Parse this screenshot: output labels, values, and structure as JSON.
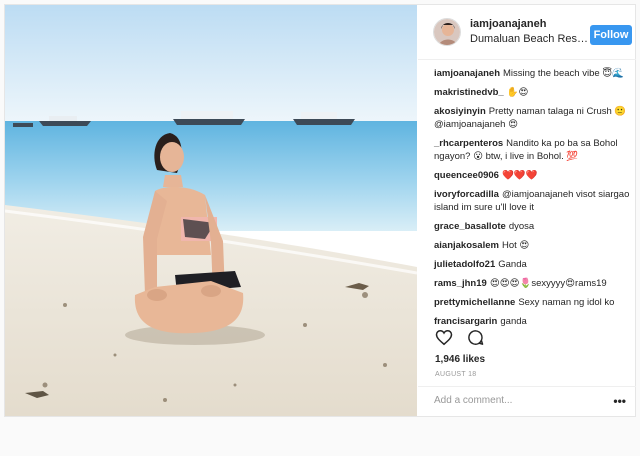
{
  "post": {
    "username": "iamjoanajaneh",
    "location": "Dumaluan Beach Resor...",
    "follow_label": "Follow",
    "likes": "1,946 likes",
    "date": "AUGUST 18",
    "add_comment_placeholder": "Add a comment...",
    "more_label": "•••"
  },
  "comments": [
    {
      "user": "iamjoanajaneh",
      "text": "Missing the beach vibe 😇🌊"
    },
    {
      "user": "makristinedvb_",
      "text": "✋😍"
    },
    {
      "user": "akosiyinyin",
      "text": "Pretty naman talaga ni Crush 🙂 @iamjoanajaneh 😍"
    },
    {
      "user": "_rhcarpenteros",
      "text": "Nandito ka po ba sa Bohol ngayon? 😮 btw, i live in Bohol. 💯"
    },
    {
      "user": "queencee0906",
      "text": "❤️❤️❤️"
    },
    {
      "user": "ivoryforcadilla",
      "text": "@iamjoanajaneh visot siargao island im sure u'll love it"
    },
    {
      "user": "grace_basallote",
      "text": "dyosa"
    },
    {
      "user": "aianjakosalem",
      "text": "Hot 😍"
    },
    {
      "user": "julietadolfo21",
      "text": "Ganda"
    },
    {
      "user": "rams_jhn19",
      "text": "😍😍😍🌷sexyyyy😍rams19"
    },
    {
      "user": "prettymichellanne",
      "text": "Sexy naman ng idol ko"
    },
    {
      "user": "francisargarin",
      "text": "ganda"
    }
  ],
  "icons": {
    "like": "heart-icon",
    "comment": "comment-bubble-icon"
  },
  "colors": {
    "follow_button": "#3897f0",
    "sky": "#cfe6f7",
    "sea": "#7fc4e6",
    "sand": "#ece6da"
  }
}
